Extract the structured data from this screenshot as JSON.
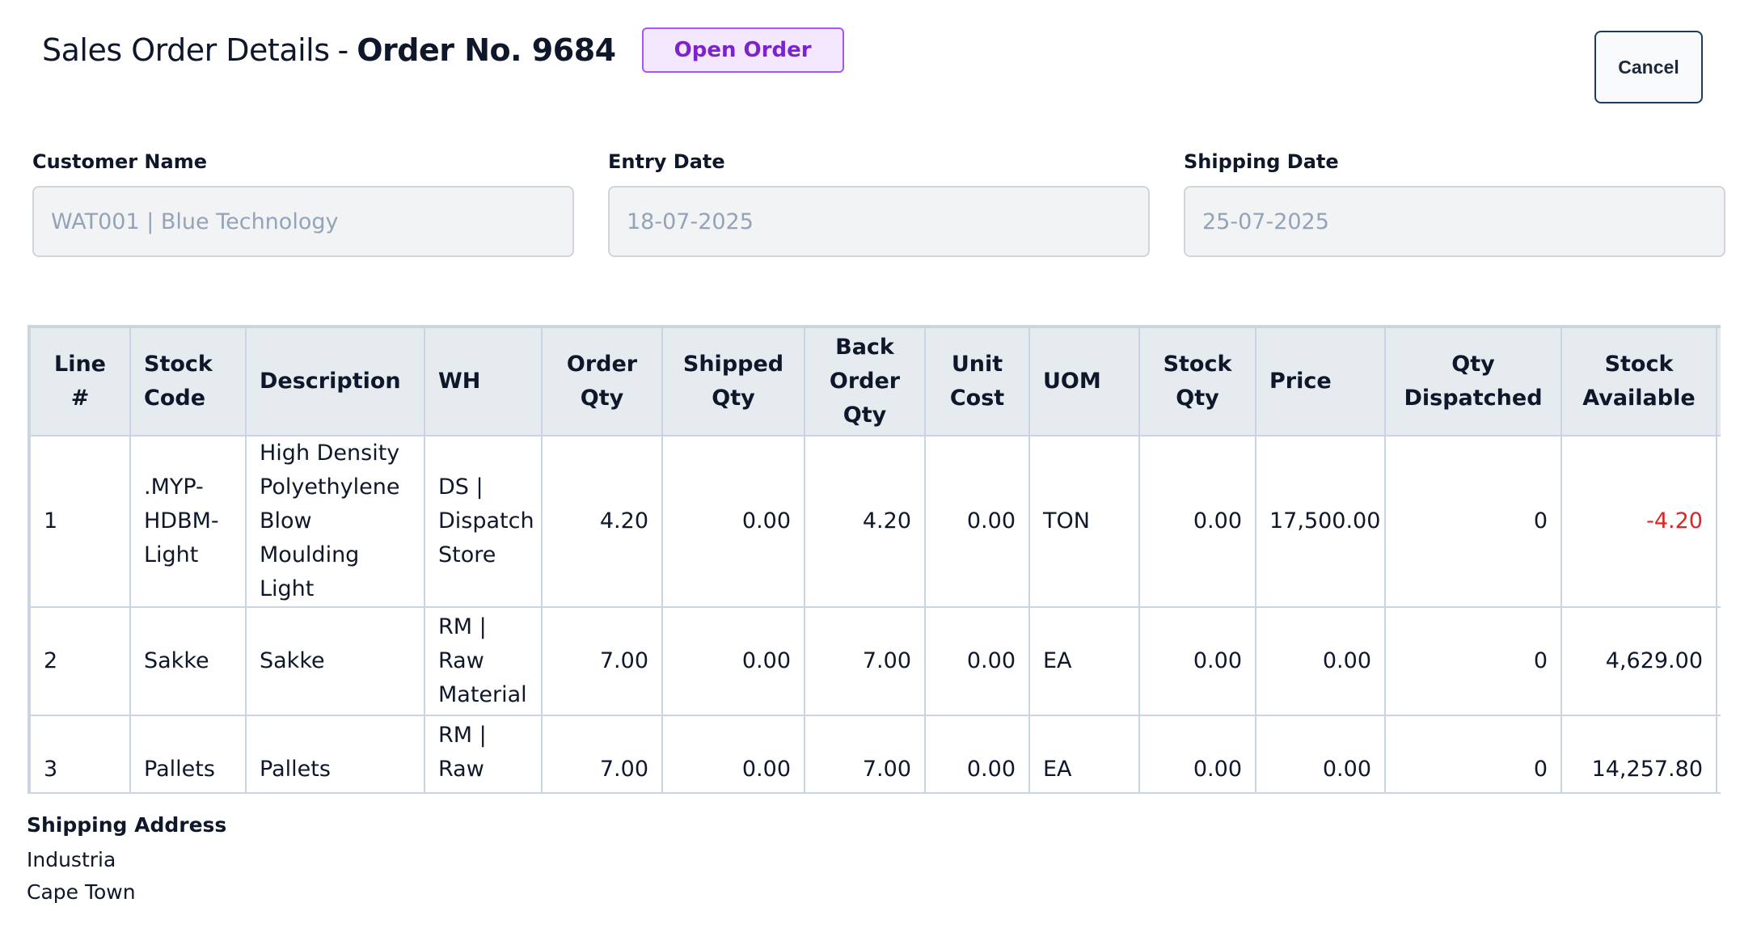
{
  "header": {
    "title_prefix": "Sales Order Details",
    "separator": "-",
    "order_label": "Order No. 9684",
    "status": "Open Order"
  },
  "actions": {
    "cancel_label": "Cancel"
  },
  "fields": {
    "customer": {
      "label": "Customer Name",
      "value": "WAT001 | Blue Technology"
    },
    "entry_date": {
      "label": "Entry Date",
      "value": "18-07-2025"
    },
    "shipping_date": {
      "label": "Shipping Date",
      "value": "25-07-2025"
    }
  },
  "table": {
    "headers": {
      "line": "Line #",
      "stock_code": "Stock Code",
      "description": "Description",
      "wh": "WH",
      "order_qty": "Order Qty",
      "shipped_qty": "Shipped Qty",
      "back_order_qty": "Back Order Qty",
      "unit_cost": "Unit Cost",
      "uom": "UOM",
      "stock_qty": "Stock Qty",
      "price": "Price",
      "qty_dispatched": "Qty Dispatched",
      "stock_available": "Stock Available",
      "extra": "("
    },
    "rows": [
      {
        "line": "1",
        "stock_code": ".MYP-HDBM-Light",
        "description": "High Density Polyethylene Blow Moulding Light",
        "wh": "DS | Dispatch Store",
        "order_qty": "4.20",
        "shipped_qty": "0.00",
        "back_order_qty": "4.20",
        "unit_cost": "0.00",
        "uom": "TON",
        "stock_qty": "0.00",
        "price": "17,500.00",
        "qty_dispatched": "0",
        "stock_available": "-4.20",
        "extra": "-"
      },
      {
        "line": "2",
        "stock_code": "Sakke",
        "description": "Sakke",
        "wh": "RM | Raw Material",
        "order_qty": "7.00",
        "shipped_qty": "0.00",
        "back_order_qty": "7.00",
        "unit_cost": "0.00",
        "uom": "EA",
        "stock_qty": "0.00",
        "price": "0.00",
        "qty_dispatched": "0",
        "stock_available": "4,629.00",
        "extra": "-"
      },
      {
        "line": "3",
        "stock_code": "Pallets",
        "description": "Pallets",
        "wh": "RM | Raw Material",
        "order_qty": "7.00",
        "shipped_qty": "0.00",
        "back_order_qty": "7.00",
        "unit_cost": "0.00",
        "uom": "EA",
        "stock_qty": "0.00",
        "price": "0.00",
        "qty_dispatched": "0",
        "stock_available": "14,257.80",
        "extra": "-"
      }
    ]
  },
  "shipping_address": {
    "title": "Shipping Address",
    "lines": [
      "Industria",
      "Cape Town"
    ]
  },
  "colors": {
    "badge_border": "#a855f7",
    "badge_text": "#7e22ce",
    "negative": "#dc2626"
  }
}
